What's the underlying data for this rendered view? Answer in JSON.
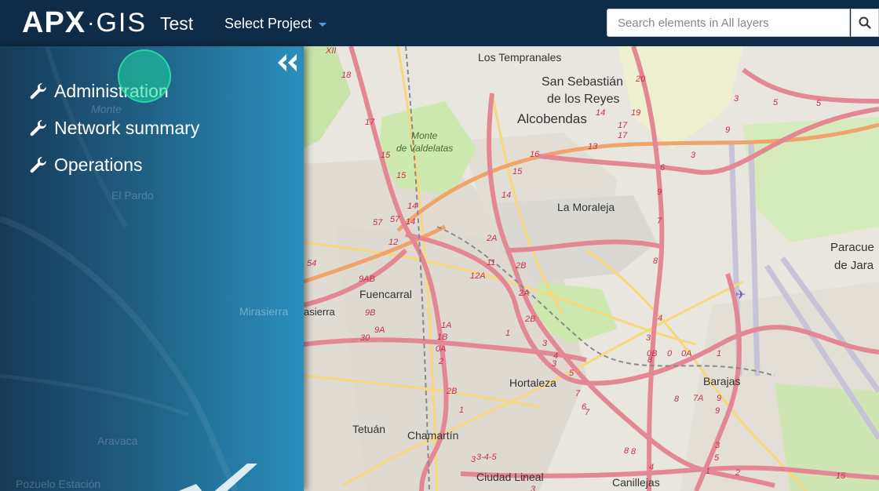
{
  "header": {
    "logo_left": "APX",
    "logo_separator": "·",
    "logo_right": "GIS",
    "app_name": "Test",
    "project_select_label": "Select Project",
    "search_placeholder": "Search elements in All layers"
  },
  "sidebar": {
    "menu_items": [
      {
        "label": "Administration",
        "icon": "wrench-icon"
      },
      {
        "label": "Network summary",
        "icon": "wrench-icon"
      },
      {
        "label": "Operations",
        "icon": "wrench-icon"
      }
    ],
    "ghost_labels": {
      "monte": "Monte",
      "el_pardo": "El Pardo",
      "aravaca": "Aravaca",
      "pozuelo": "Pozuelo Estación",
      "mirasierra": "Mirasierra"
    }
  },
  "map": {
    "places": {
      "los_tempranales": "Los Tempranales",
      "san_sebastian_1": "San Sebastián",
      "san_sebastian_2": "de los Reyes",
      "alcobendas": "Alcobendas",
      "monte_1": "Monte",
      "monte_2": "de Valdelatas",
      "la_moraleja": "La Moraleja",
      "paracuellos_1": "Paracue",
      "paracuellos_2": "de Jara",
      "fuencarral": "Fuencarral",
      "mirasierra": "Mirasierra",
      "hortaleza": "Hortaleza",
      "barajas": "Barajas",
      "tetuan": "Tetuán",
      "chamartin": "Chamartín",
      "ciudad_lineal": "Ciudad Lineal",
      "canillejas": "Canillejas"
    },
    "road_labels": [
      "XII",
      "18",
      "17",
      "15",
      "15",
      "14",
      "57",
      "14",
      "12",
      "57",
      "54",
      "9AB",
      "9B",
      "9A",
      "30",
      "1A",
      "1B",
      "0A",
      "2",
      "16",
      "15",
      "14",
      "17",
      "20",
      "19",
      "17",
      "14",
      "13",
      "11",
      "12A",
      "2A",
      "2B",
      "2A",
      "2B",
      "1",
      "3",
      "4",
      "3",
      "5",
      "7",
      "8",
      "9",
      "6",
      "3",
      "3",
      "5",
      "5",
      "9",
      "7",
      "8",
      "4",
      "3",
      "0B",
      "0",
      "0A",
      "1",
      "8",
      "7A",
      "9",
      "9",
      "3",
      "5",
      "6",
      "7",
      "8",
      "8",
      "4",
      "3-4-5",
      "2B",
      "1",
      "3",
      "15",
      "1",
      "2",
      "3",
      "2"
    ]
  },
  "colors": {
    "topbar": "#0e2c47",
    "sidebar_from": "#173a57",
    "sidebar_to": "#2a8fbd",
    "ripple": "#1ed7a0",
    "caret": "#4aa3df",
    "road_major": "#e48794",
    "road_trunk": "#f0a36a",
    "road_secondary": "#f7d87a",
    "park": "#cde9b0",
    "urban": "#e0dcd4"
  }
}
